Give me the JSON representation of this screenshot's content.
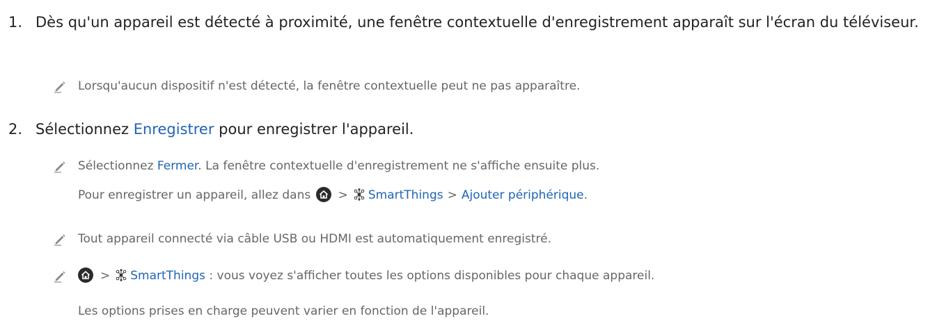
{
  "step1": {
    "number": "1.",
    "text": "Dès qu'un appareil est détecté à proximité, une fenêtre contextuelle d'enregistrement apparaît sur l'écran du téléviseur."
  },
  "note1": {
    "text": "Lorsqu'aucun dispositif n'est détecté, la fenêtre contextuelle peut ne pas apparaître."
  },
  "step2": {
    "number": "2.",
    "text_before": "Sélectionnez ",
    "link": "Enregistrer",
    "text_after": " pour enregistrer l'appareil."
  },
  "note2": {
    "text_before": "Sélectionnez ",
    "link": "Fermer",
    "text_after": ". La fenêtre contextuelle d'enregistrement ne s'affiche ensuite plus.",
    "path_intro": "Pour enregistrer un appareil, allez dans ",
    "path_separator": ">",
    "path_smartthings": "SmartThings",
    "path_add": "Ajouter périphérique",
    "path_end": "."
  },
  "note3": {
    "text": "Tout appareil connecté via câble USB ou HDMI est automatiquement enregistré."
  },
  "note4": {
    "separator": ">",
    "smartthings": "SmartThings",
    "text": " : vous voyez s'afficher toutes les options disponibles pour chaque appareil.",
    "continuation": "Les options prises en charge peuvent varier en fonction de l'appareil."
  },
  "colors": {
    "link": "#1f64b4",
    "note_text": "#666666",
    "body_text": "#222222"
  },
  "icons": [
    "pencil-note-icon",
    "home-icon",
    "smartthings-icon"
  ]
}
